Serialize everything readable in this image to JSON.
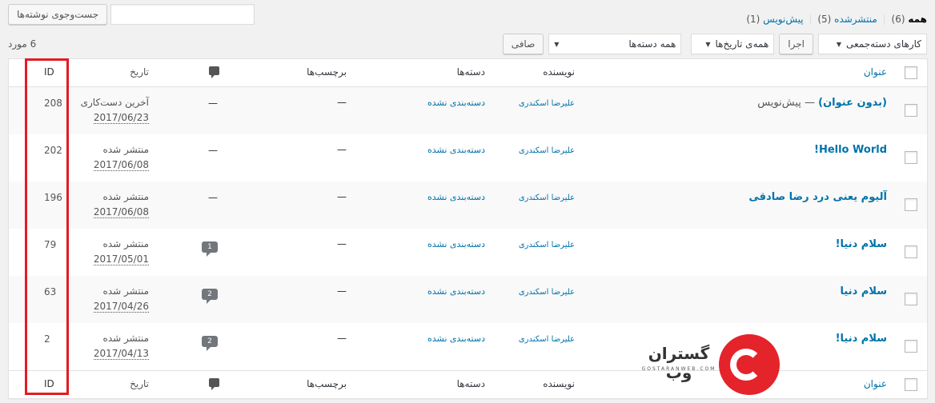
{
  "search": {
    "button_label": "جست‌وجوی نوشته‌ها",
    "input_value": ""
  },
  "views": {
    "all_label": "همه",
    "all_count": "(6)",
    "published_label": "منتشرشده",
    "published_count": "(5)",
    "draft_label": "پیش‌نویس",
    "draft_count": "(1)",
    "separator": "|"
  },
  "filters": {
    "bulk_actions": "کارهای دسته‌جمعی",
    "apply": "اجرا",
    "dates": "همه‌ی تاریخ‌ها",
    "categories": "همه دسته‌ها",
    "filter": "صافی",
    "items_count": "6 مورد"
  },
  "columns": {
    "title": "عنوان",
    "author": "نویسنده",
    "categories": "دسته‌ها",
    "tags": "برچسب‌ها",
    "date": "تاریخ",
    "id": "ID"
  },
  "rows": [
    {
      "title": "(بدون عنوان)",
      "state": " — پیش‌نویس",
      "author": "علیرضا اسکندری",
      "category": "دسته‌بندی نشده",
      "tags": "—",
      "comments": "—",
      "status": "آخرین دست‌کاری",
      "date": "2017/06/23",
      "id": "208"
    },
    {
      "title": "Hello World!",
      "state": "",
      "author": "علیرضا اسکندری",
      "category": "دسته‌بندی نشده",
      "tags": "—",
      "comments": "—",
      "status": "منتشر شده",
      "date": "2017/06/08",
      "id": "202"
    },
    {
      "title": "آلیوم یعنی درد رضا صادقی",
      "state": "",
      "author": "علیرضا اسکندری",
      "category": "دسته‌بندی نشده",
      "tags": "—",
      "comments": "—",
      "status": "منتشر شده",
      "date": "2017/06/08",
      "id": "196"
    },
    {
      "title": "سلام دنیا!",
      "state": "",
      "author": "علیرضا اسکندری",
      "category": "دسته‌بندی نشده",
      "tags": "—",
      "comments": "1",
      "status": "منتشر شده",
      "date": "2017/05/01",
      "id": "79"
    },
    {
      "title": "سلام دنیا",
      "state": "",
      "author": "علیرضا اسکندری",
      "category": "دسته‌بندی نشده",
      "tags": "—",
      "comments": "2",
      "status": "منتشر شده",
      "date": "2017/04/26",
      "id": "63"
    },
    {
      "title": "سلام دنیا!",
      "state": "",
      "author": "علیرضا اسکندری",
      "category": "دسته‌بندی نشده",
      "tags": "—",
      "comments": "2",
      "status": "منتشر شده",
      "date": "2017/04/13",
      "id": "2"
    }
  ],
  "logo": {
    "name": "گستران وب",
    "url_text": "GOSTARANWEB.COM"
  },
  "colors": {
    "link": "#0073aa",
    "highlight": "#e31b23",
    "logo": "#e5232a"
  }
}
